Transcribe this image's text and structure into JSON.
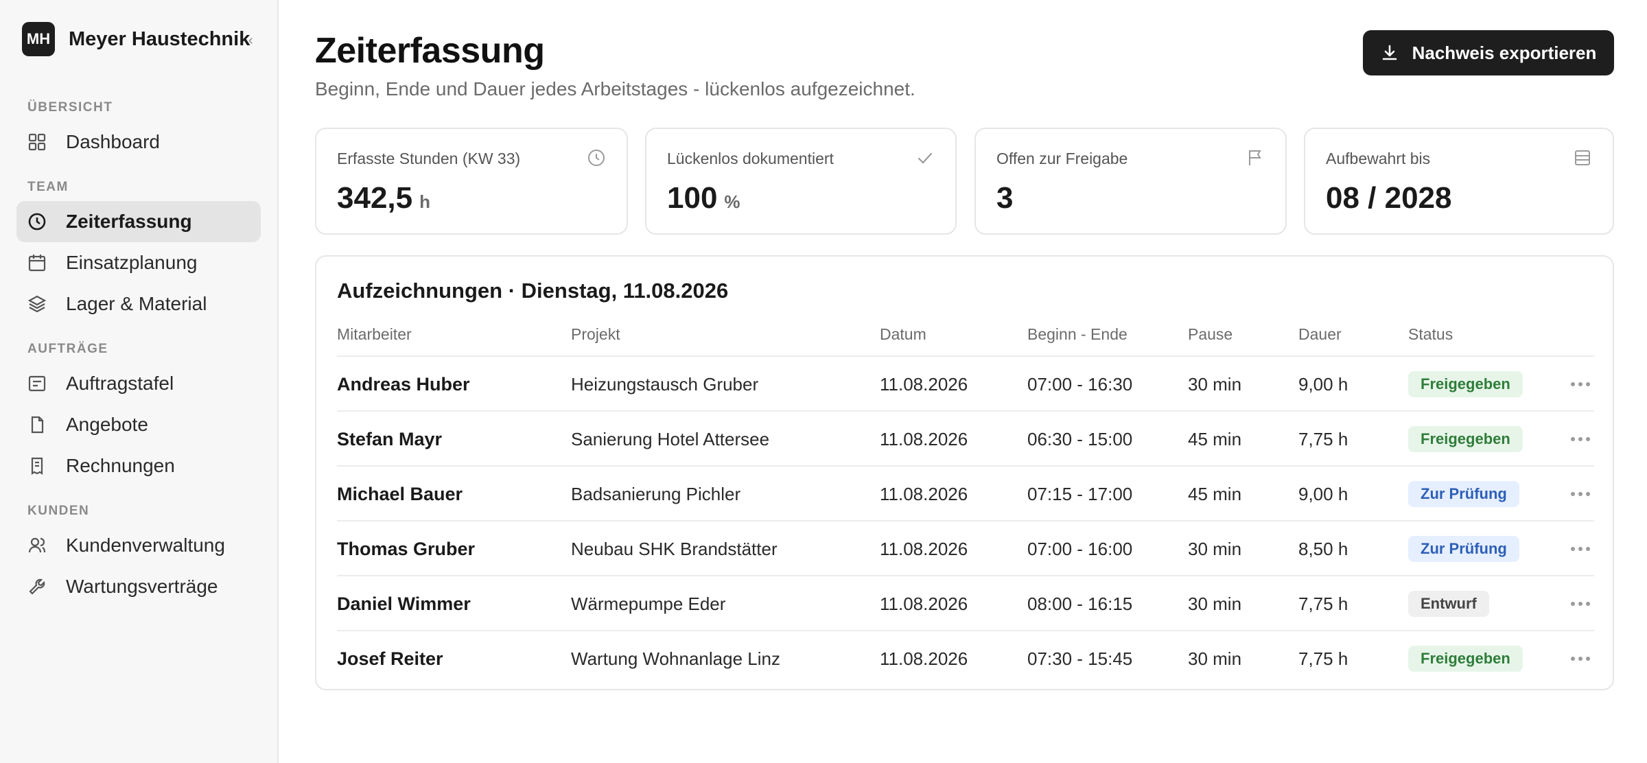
{
  "brand": {
    "initials": "MH",
    "name": "Meyer Haustechnik",
    "collapse": "‹"
  },
  "sidebar": {
    "sections": [
      "ÜBERSICHT",
      "TEAM",
      "AUFTRÄGE",
      "KUNDEN"
    ],
    "items": [
      {
        "label": "Dashboard",
        "icon": "grid-icon"
      },
      {
        "label": "Zeiterfassung",
        "icon": "clock-icon",
        "active": true
      },
      {
        "label": "Einsatzplanung",
        "icon": "calendar-icon"
      },
      {
        "label": "Lager & Material",
        "icon": "layers-icon"
      },
      {
        "label": "Auftragstafel",
        "icon": "board-icon"
      },
      {
        "label": "Angebote",
        "icon": "file-icon"
      },
      {
        "label": "Rechnungen",
        "icon": "receipt-icon"
      },
      {
        "label": "Kundenverwaltung",
        "icon": "users-icon"
      },
      {
        "label": "Wartungsverträge",
        "icon": "wrench-icon"
      }
    ]
  },
  "header": {
    "title": "Zeiterfassung",
    "subtitle": "Beginn, Ende und Dauer jedes Arbeitstages - lückenlos aufgezeichnet.",
    "export_label": "Nachweis exportieren"
  },
  "stats": [
    {
      "label": "Erfasste Stunden (KW 33)",
      "value": "342,5",
      "unit": "h",
      "icon": "clock-icon"
    },
    {
      "label": "Lückenlos dokumentiert",
      "value": "100",
      "unit": "%",
      "icon": "check-icon"
    },
    {
      "label": "Offen zur Freigabe",
      "value": "3",
      "unit": "",
      "icon": "flag-icon"
    },
    {
      "label": "Aufbewahrt bis",
      "value": "08 / 2028",
      "unit": "",
      "icon": "archive-icon"
    }
  ],
  "table": {
    "title": "Aufzeichnungen · Dienstag, 11.08.2026",
    "columns": [
      "Mitarbeiter",
      "Projekt",
      "Datum",
      "Beginn - Ende",
      "Pause",
      "Dauer",
      "Status"
    ],
    "rows": [
      {
        "employee": "Andreas Huber",
        "project": "Heizungstausch Gruber",
        "date": "11.08.2026",
        "time": "07:00 - 16:30",
        "pause": "30 min",
        "duration": "9,00 h",
        "status": "Freigegeben",
        "status_kind": "ok"
      },
      {
        "employee": "Stefan Mayr",
        "project": "Sanierung Hotel Attersee",
        "date": "11.08.2026",
        "time": "06:30 - 15:00",
        "pause": "45 min",
        "duration": "7,75 h",
        "status": "Freigegeben",
        "status_kind": "ok"
      },
      {
        "employee": "Michael Bauer",
        "project": "Badsanierung Pichler",
        "date": "11.08.2026",
        "time": "07:15 - 17:00",
        "pause": "45 min",
        "duration": "9,00 h",
        "status": "Zur Prüfung",
        "status_kind": "review"
      },
      {
        "employee": "Thomas Gruber",
        "project": "Neubau SHK Brandstätter",
        "date": "11.08.2026",
        "time": "07:00 - 16:00",
        "pause": "30 min",
        "duration": "8,50 h",
        "status": "Zur Prüfung",
        "status_kind": "review"
      },
      {
        "employee": "Daniel Wimmer",
        "project": "Wärmepumpe Eder",
        "date": "11.08.2026",
        "time": "08:00 - 16:15",
        "pause": "30 min",
        "duration": "7,75 h",
        "status": "Entwurf",
        "status_kind": "draft"
      },
      {
        "employee": "Josef Reiter",
        "project": "Wartung Wohnanlage Linz",
        "date": "11.08.2026",
        "time": "07:30 - 15:45",
        "pause": "30 min",
        "duration": "7,75 h",
        "status": "Freigegeben",
        "status_kind": "ok"
      }
    ]
  },
  "colors": {
    "accent": "#1e1e1e",
    "status_ok_bg": "#e7f5e9",
    "status_ok_fg": "#2f7d3a",
    "status_review_bg": "#e6efff",
    "status_review_fg": "#2d5fb8",
    "status_draft_bg": "#efefef",
    "status_draft_fg": "#444444"
  }
}
